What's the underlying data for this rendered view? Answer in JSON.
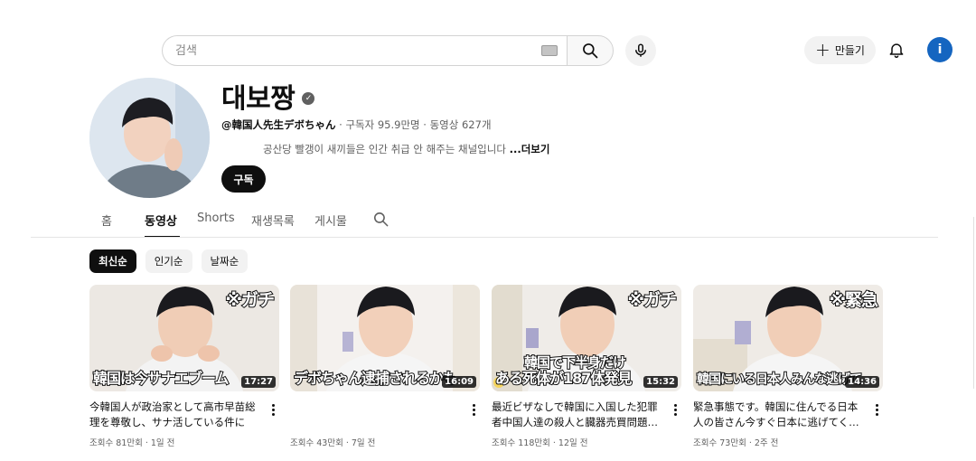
{
  "topbar": {
    "search_placeholder": "검색",
    "create_label": "만들기",
    "account_initial": "i"
  },
  "channel": {
    "name": "대보짱",
    "handle": "@韓国人先生デボちゃん",
    "stats": " · 구독자 95.9만명 · 동영상 627개",
    "description": "공산당 빨갱이 새끼들은 인간 취급 안 해주는 채널입니다",
    "more_label": "...더보기",
    "subscribe_label": "구독"
  },
  "tabs": [
    {
      "label": "홈",
      "active": false
    },
    {
      "label": "동영상",
      "active": true
    },
    {
      "label": "Shorts",
      "active": false
    },
    {
      "label": "재생목록",
      "active": false
    },
    {
      "label": "게시물",
      "active": false
    }
  ],
  "filters": [
    {
      "label": "최신순",
      "active": true
    },
    {
      "label": "인기순",
      "active": false
    },
    {
      "label": "날짜순",
      "active": false
    }
  ],
  "videos": [
    {
      "title": "今韓国人が政治家として高市早苗総理を尊敬し、サナ活している件につ…",
      "meta": "조회수 81만회 · 1일 전",
      "duration": "17:27",
      "caption_top": "※ガチ",
      "caption_bottom": "韓国は今サナエブーム"
    },
    {
      "title": "",
      "meta": "조회수 43만회 · 7일 전",
      "duration": "16:09",
      "caption_top": "",
      "caption_bottom": "デボちゃん逮捕されるかも"
    },
    {
      "title": "最近ビザなしで韓国に入国した犯罪者中国人達の殺人と臓器売買問題…",
      "meta": "조회수 118만회 · 12일 전",
      "duration": "15:32",
      "caption_top": "※ガチ",
      "caption_bottom": "ある死体が187体発見",
      "caption_bottom2": "韓国で下半身だけ"
    },
    {
      "title": "緊急事態です。韓国に住んでる日本人の皆さん今すぐ日本に逃げてく…",
      "meta": "조회수 73만회 · 2주 전",
      "duration": "14:36",
      "caption_top": "※緊急",
      "caption_bottom": "韓国にいる日本人みんな逃げて"
    }
  ],
  "colors": {
    "text_primary": "#0f0f0f",
    "text_secondary": "#606060",
    "chip_bg": "#f2f2f2",
    "account_blue": "#1565c0"
  }
}
